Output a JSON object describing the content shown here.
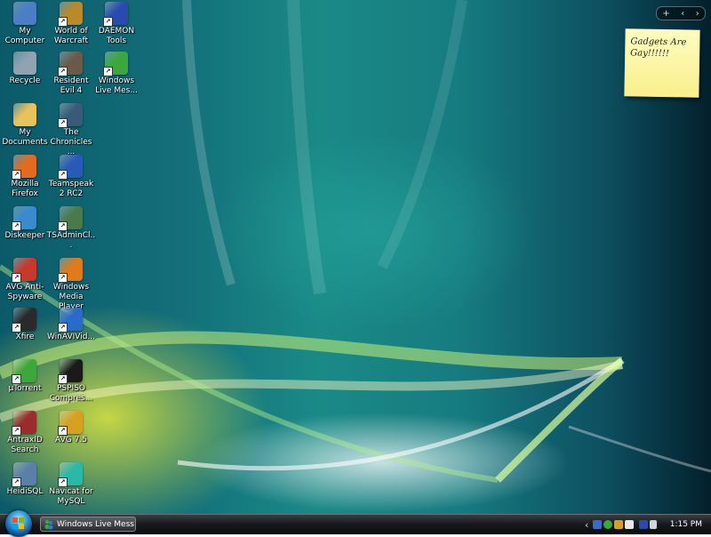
{
  "desktop_icons": [
    {
      "label": "My Computer",
      "icon": "computer-icon",
      "color": "#4a7fc8"
    },
    {
      "label": "Recycle",
      "icon": "recycle-bin-icon",
      "color": "#8fa3b0"
    },
    {
      "label": "My Documents",
      "icon": "documents-folder-icon",
      "color": "#e8c25a"
    },
    {
      "label": "Mozilla Firefox",
      "icon": "firefox-icon",
      "color": "#e46a1f"
    },
    {
      "label": "Diskeeper",
      "icon": "diskeeper-icon",
      "color": "#3a8ad0"
    },
    {
      "label": "AVG Anti-Spyware",
      "icon": "avg-antispyware-icon",
      "color": "#c8392c"
    },
    {
      "label": "Xfire",
      "icon": "xfire-icon",
      "color": "#2a2a2a"
    },
    {
      "label": "µTorrent",
      "icon": "utorrent-icon",
      "color": "#3ea63a"
    },
    {
      "label": "AntraxID Search",
      "icon": "antraxid-icon",
      "color": "#9a2c2c"
    },
    {
      "label": "HeidiSQL",
      "icon": "heidisql-icon",
      "color": "#5a7fa8"
    },
    {
      "label": "World of Warcraft",
      "icon": "world-of-warcraft-icon",
      "color": "#b88a2a"
    },
    {
      "label": "Resident Evil 4",
      "icon": "resident-evil-4-icon",
      "color": "#6a5a4a"
    },
    {
      "label": "The Chronicles ...",
      "icon": "chronicles-icon",
      "color": "#3a5a7a"
    },
    {
      "label": "Teamspeak 2 RC2",
      "icon": "teamspeak-icon",
      "color": "#2a5ab8"
    },
    {
      "label": "TSAdminCl...",
      "icon": "tsadmin-icon",
      "color": "#4a7a4a"
    },
    {
      "label": "Windows Media Player",
      "icon": "windows-media-player-icon",
      "color": "#e07a1a"
    },
    {
      "label": "WinAVIVid...",
      "icon": "winavi-icon",
      "color": "#2a6ac8"
    },
    {
      "label": "PSPISO Compres...",
      "icon": "pspiso-icon",
      "color": "#1a1a1a"
    },
    {
      "label": "AVG 7.5",
      "icon": "avg-icon",
      "color": "#d8a020"
    },
    {
      "label": "Navicat for MySQL",
      "icon": "navicat-icon",
      "color": "#2ab8a8"
    },
    {
      "label": "DAEMON Tools",
      "icon": "daemon-tools-icon",
      "color": "#2a4ab0"
    },
    {
      "label": "Windows Live Mes...",
      "icon": "windows-live-messenger-icon",
      "color": "#3aa83a"
    }
  ],
  "sticky_note": {
    "text": "Gadgets Are Gay!!!!!!"
  },
  "sidebar_control": {
    "add": "+",
    "prev": "‹",
    "next": "›"
  },
  "taskbar": {
    "task_label": "Windows Live Mess...",
    "tray_chevron": "‹",
    "clock": "1:15 PM"
  }
}
